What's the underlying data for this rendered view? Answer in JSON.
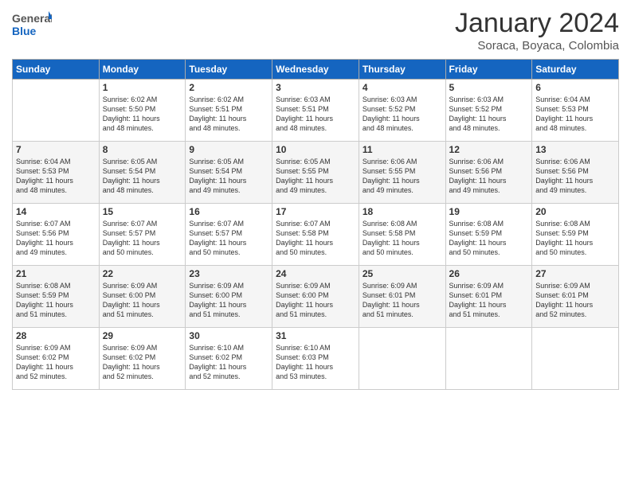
{
  "logo": {
    "text_general": "General",
    "text_blue": "Blue"
  },
  "title": "January 2024",
  "subtitle": "Soraca, Boyaca, Colombia",
  "header_days": [
    "Sunday",
    "Monday",
    "Tuesday",
    "Wednesday",
    "Thursday",
    "Friday",
    "Saturday"
  ],
  "weeks": [
    [
      {
        "day": "",
        "content": ""
      },
      {
        "day": "1",
        "content": "Sunrise: 6:02 AM\nSunset: 5:50 PM\nDaylight: 11 hours\nand 48 minutes."
      },
      {
        "day": "2",
        "content": "Sunrise: 6:02 AM\nSunset: 5:51 PM\nDaylight: 11 hours\nand 48 minutes."
      },
      {
        "day": "3",
        "content": "Sunrise: 6:03 AM\nSunset: 5:51 PM\nDaylight: 11 hours\nand 48 minutes."
      },
      {
        "day": "4",
        "content": "Sunrise: 6:03 AM\nSunset: 5:52 PM\nDaylight: 11 hours\nand 48 minutes."
      },
      {
        "day": "5",
        "content": "Sunrise: 6:03 AM\nSunset: 5:52 PM\nDaylight: 11 hours\nand 48 minutes."
      },
      {
        "day": "6",
        "content": "Sunrise: 6:04 AM\nSunset: 5:53 PM\nDaylight: 11 hours\nand 48 minutes."
      }
    ],
    [
      {
        "day": "7",
        "content": "Sunrise: 6:04 AM\nSunset: 5:53 PM\nDaylight: 11 hours\nand 48 minutes."
      },
      {
        "day": "8",
        "content": "Sunrise: 6:05 AM\nSunset: 5:54 PM\nDaylight: 11 hours\nand 48 minutes."
      },
      {
        "day": "9",
        "content": "Sunrise: 6:05 AM\nSunset: 5:54 PM\nDaylight: 11 hours\nand 49 minutes."
      },
      {
        "day": "10",
        "content": "Sunrise: 6:05 AM\nSunset: 5:55 PM\nDaylight: 11 hours\nand 49 minutes."
      },
      {
        "day": "11",
        "content": "Sunrise: 6:06 AM\nSunset: 5:55 PM\nDaylight: 11 hours\nand 49 minutes."
      },
      {
        "day": "12",
        "content": "Sunrise: 6:06 AM\nSunset: 5:56 PM\nDaylight: 11 hours\nand 49 minutes."
      },
      {
        "day": "13",
        "content": "Sunrise: 6:06 AM\nSunset: 5:56 PM\nDaylight: 11 hours\nand 49 minutes."
      }
    ],
    [
      {
        "day": "14",
        "content": "Sunrise: 6:07 AM\nSunset: 5:56 PM\nDaylight: 11 hours\nand 49 minutes."
      },
      {
        "day": "15",
        "content": "Sunrise: 6:07 AM\nSunset: 5:57 PM\nDaylight: 11 hours\nand 50 minutes."
      },
      {
        "day": "16",
        "content": "Sunrise: 6:07 AM\nSunset: 5:57 PM\nDaylight: 11 hours\nand 50 minutes."
      },
      {
        "day": "17",
        "content": "Sunrise: 6:07 AM\nSunset: 5:58 PM\nDaylight: 11 hours\nand 50 minutes."
      },
      {
        "day": "18",
        "content": "Sunrise: 6:08 AM\nSunset: 5:58 PM\nDaylight: 11 hours\nand 50 minutes."
      },
      {
        "day": "19",
        "content": "Sunrise: 6:08 AM\nSunset: 5:59 PM\nDaylight: 11 hours\nand 50 minutes."
      },
      {
        "day": "20",
        "content": "Sunrise: 6:08 AM\nSunset: 5:59 PM\nDaylight: 11 hours\nand 50 minutes."
      }
    ],
    [
      {
        "day": "21",
        "content": "Sunrise: 6:08 AM\nSunset: 5:59 PM\nDaylight: 11 hours\nand 51 minutes."
      },
      {
        "day": "22",
        "content": "Sunrise: 6:09 AM\nSunset: 6:00 PM\nDaylight: 11 hours\nand 51 minutes."
      },
      {
        "day": "23",
        "content": "Sunrise: 6:09 AM\nSunset: 6:00 PM\nDaylight: 11 hours\nand 51 minutes."
      },
      {
        "day": "24",
        "content": "Sunrise: 6:09 AM\nSunset: 6:00 PM\nDaylight: 11 hours\nand 51 minutes."
      },
      {
        "day": "25",
        "content": "Sunrise: 6:09 AM\nSunset: 6:01 PM\nDaylight: 11 hours\nand 51 minutes."
      },
      {
        "day": "26",
        "content": "Sunrise: 6:09 AM\nSunset: 6:01 PM\nDaylight: 11 hours\nand 51 minutes."
      },
      {
        "day": "27",
        "content": "Sunrise: 6:09 AM\nSunset: 6:01 PM\nDaylight: 11 hours\nand 52 minutes."
      }
    ],
    [
      {
        "day": "28",
        "content": "Sunrise: 6:09 AM\nSunset: 6:02 PM\nDaylight: 11 hours\nand 52 minutes."
      },
      {
        "day": "29",
        "content": "Sunrise: 6:09 AM\nSunset: 6:02 PM\nDaylight: 11 hours\nand 52 minutes."
      },
      {
        "day": "30",
        "content": "Sunrise: 6:10 AM\nSunset: 6:02 PM\nDaylight: 11 hours\nand 52 minutes."
      },
      {
        "day": "31",
        "content": "Sunrise: 6:10 AM\nSunset: 6:03 PM\nDaylight: 11 hours\nand 53 minutes."
      },
      {
        "day": "",
        "content": ""
      },
      {
        "day": "",
        "content": ""
      },
      {
        "day": "",
        "content": ""
      }
    ]
  ]
}
